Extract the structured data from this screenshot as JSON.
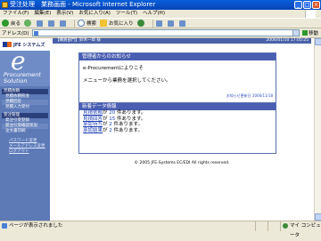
{
  "window": {
    "title": "受注处理　業務画面 - Microsoft Internet Explorer"
  },
  "menubar": {
    "items": [
      "ファイル(F)",
      "編集(E)",
      "表示(V)",
      "お気に入り(A)",
      "ツール(T)",
      "ヘルプ(H)"
    ]
  },
  "toolbar": {
    "back_label": "戻る",
    "search_label": "検索",
    "favorites_label": "お気に入り"
  },
  "address": {
    "label": "アドレス(D)",
    "value": "",
    "go_label": "移動"
  },
  "sidebar": {
    "company": "JFE システムズ",
    "product_line1": "Procurement",
    "product_line2": "Solution",
    "sections": [
      {
        "title": "見積依頼",
        "items": [
          "見積依頼照会",
          "見積回答",
          "見積入力受付"
        ]
      },
      {
        "title": "受注管理",
        "items": [
          "発注引受登録",
          "発注引受確認状況",
          "注文書印刷"
        ]
      }
    ],
    "links": [
      "パスワード変更",
      "メールアドレス変更",
      "ログアウト"
    ]
  },
  "main": {
    "header_left": "【購買部門】鈴木一郎 様",
    "header_right": "2006/01/10 17:05:25",
    "notice": {
      "title": "管理者からのお知らせ",
      "welcome": "e-Procurementによりこそ",
      "instruction": "メニューから業務を選択してください。",
      "updated": "お知らせ更新日 2006/11/18"
    },
    "new_data": {
      "title": "新着データ情報",
      "rows": [
        {
          "link": "見積依頼",
          "mid": "が",
          "count": "20",
          "suffix": "件あります。"
        },
        {
          "link": "見積回答",
          "mid": "が",
          "count": "15",
          "suffix": "件あります。"
        },
        {
          "link": "承認待ち",
          "mid": "が",
          "count": "2",
          "suffix": "件あります。"
        },
        {
          "link": "承認結果",
          "mid": "が",
          "count": "2",
          "suffix": "件あります。"
        }
      ]
    },
    "copyright": "© 2005 JFE-Systems EC/EDI All rights reserved."
  },
  "statusbar": {
    "text": "ページが表示されました",
    "zone": "マイ コンピュータ"
  }
}
